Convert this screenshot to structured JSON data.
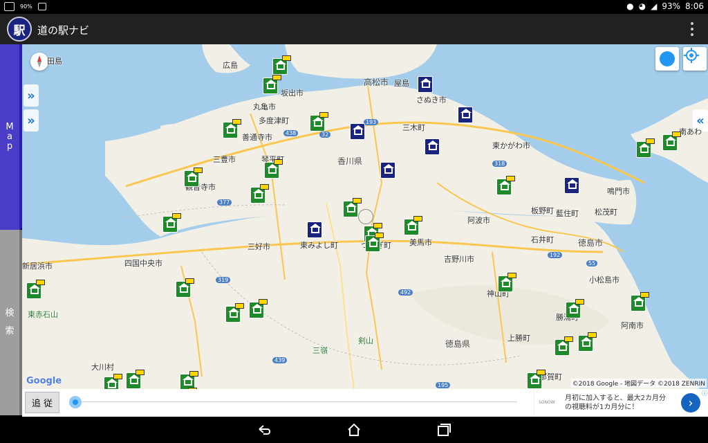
{
  "status_bar": {
    "battery_small": "90%",
    "battery": "93%",
    "time": "8:06",
    "left_icons": [
      "keyboard-icon",
      "battery-saver-icon",
      "image-icon"
    ],
    "right_icons": [
      "location-icon",
      "wifi-icon",
      "signal-icon"
    ]
  },
  "app_bar": {
    "logo_text": "駅",
    "title": "道の駅ナビ",
    "menu_icon": "overflow-menu-icon"
  },
  "side_tabs": {
    "map": [
      "M",
      "a",
      "p"
    ],
    "search": [
      "検",
      "索"
    ]
  },
  "map": {
    "place_labels": [
      {
        "name": "田島",
        "kind": "normal"
      },
      {
        "name": "広島",
        "kind": "normal"
      },
      {
        "name": "坂出市",
        "kind": "normal"
      },
      {
        "name": "高松市",
        "kind": "big"
      },
      {
        "name": "屋島",
        "kind": "normal"
      },
      {
        "name": "さぬき市",
        "kind": "normal"
      },
      {
        "name": "丸亀市",
        "kind": "normal"
      },
      {
        "name": "多度津町",
        "kind": "normal"
      },
      {
        "name": "善通寺市",
        "kind": "normal"
      },
      {
        "name": "三木町",
        "kind": "normal"
      },
      {
        "name": "東かがわ市",
        "kind": "normal"
      },
      {
        "name": "南あわ",
        "kind": "normal"
      },
      {
        "name": "三豊市",
        "kind": "normal"
      },
      {
        "name": "琴平町",
        "kind": "normal"
      },
      {
        "name": "香川県",
        "kind": "big"
      },
      {
        "name": "観音寺市",
        "kind": "normal"
      },
      {
        "name": "鳴門市",
        "kind": "normal"
      },
      {
        "name": "板野町",
        "kind": "normal"
      },
      {
        "name": "藍住町",
        "kind": "normal"
      },
      {
        "name": "松茂町",
        "kind": "normal"
      },
      {
        "name": "阿波市",
        "kind": "normal"
      },
      {
        "name": "石井町",
        "kind": "normal"
      },
      {
        "name": "三好市",
        "kind": "normal"
      },
      {
        "name": "東みよし町",
        "kind": "normal"
      },
      {
        "name": "つるぎ町",
        "kind": "normal"
      },
      {
        "name": "美馬市",
        "kind": "normal"
      },
      {
        "name": "徳島市",
        "kind": "big"
      },
      {
        "name": "四国中央市",
        "kind": "normal"
      },
      {
        "name": "吉野川市",
        "kind": "normal"
      },
      {
        "name": "新居浜市",
        "kind": "normal"
      },
      {
        "name": "小松島市",
        "kind": "normal"
      },
      {
        "name": "神山町",
        "kind": "normal"
      },
      {
        "name": "勝浦町",
        "kind": "normal"
      },
      {
        "name": "東赤石山",
        "kind": "green"
      },
      {
        "name": "阿南市",
        "kind": "normal"
      },
      {
        "name": "剣山",
        "kind": "green"
      },
      {
        "name": "上勝町",
        "kind": "normal"
      },
      {
        "name": "三嶺",
        "kind": "green"
      },
      {
        "name": "徳島県",
        "kind": "big"
      },
      {
        "name": "大川村",
        "kind": "normal"
      },
      {
        "name": "那賀町",
        "kind": "normal"
      }
    ],
    "road_shields": [
      "438",
      "32",
      "193",
      "318",
      "377",
      "319",
      "192",
      "55",
      "492",
      "439",
      "195"
    ],
    "markers": [
      {
        "kind": "green",
        "flag": true
      },
      {
        "kind": "green",
        "flag": true
      },
      {
        "kind": "blue",
        "flag": false
      },
      {
        "kind": "blue",
        "flag": false
      },
      {
        "kind": "blue",
        "flag": false
      },
      {
        "kind": "green",
        "flag": true
      },
      {
        "kind": "green",
        "flag": true
      },
      {
        "kind": "blue",
        "flag": false
      },
      {
        "kind": "blue",
        "flag": false
      },
      {
        "kind": "green",
        "flag": true
      },
      {
        "kind": "green",
        "flag": true
      },
      {
        "kind": "green",
        "flag": true
      },
      {
        "kind": "blue",
        "flag": false
      },
      {
        "kind": "green",
        "flag": true
      },
      {
        "kind": "green",
        "flag": true
      },
      {
        "kind": "green",
        "flag": true
      },
      {
        "kind": "green",
        "flag": true
      },
      {
        "kind": "green",
        "flag": true
      },
      {
        "kind": "blue",
        "flag": false
      },
      {
        "kind": "green",
        "flag": true
      },
      {
        "kind": "green",
        "flag": true
      },
      {
        "kind": "green",
        "flag": true
      },
      {
        "kind": "green",
        "flag": true
      },
      {
        "kind": "green",
        "flag": true
      },
      {
        "kind": "green",
        "flag": true
      },
      {
        "kind": "green",
        "flag": true
      },
      {
        "kind": "green",
        "flag": true
      },
      {
        "kind": "green",
        "flag": true
      },
      {
        "kind": "green",
        "flag": true
      },
      {
        "kind": "green",
        "flag": true
      },
      {
        "kind": "green",
        "flag": true
      },
      {
        "kind": "green",
        "flag": true
      },
      {
        "kind": "green",
        "flag": true
      },
      {
        "kind": "green",
        "flag": true
      },
      {
        "kind": "green",
        "flag": true
      },
      {
        "kind": "green",
        "flag": true
      }
    ],
    "google_logo": "Google",
    "copyright": "©2018 Google - 地図データ ©2018 ZENRIN",
    "buttons": {
      "compass": "compass-icon",
      "navigation": "navigation-icon",
      "my_location": "my-location-icon",
      "expand_left_1": "»",
      "expand_left_2": "»",
      "expand_right": "«"
    }
  },
  "bottom_bar": {
    "follow_label": "追 従",
    "slider_value": 0
  },
  "ad": {
    "brand": "SONOW",
    "text_line1": "月初に加入すると、最大2カ月分",
    "text_line2": "の視聴料が1カ月分に！",
    "button": "›",
    "close": "ⓘ"
  },
  "nav_bar": {
    "back": "back-icon",
    "home": "home-icon",
    "recents": "recents-icon"
  },
  "colors": {
    "app_bar": "#212121",
    "map_tab": "#4b3cc7",
    "search_tab": "#9e9e9e",
    "water": "#a3cdea",
    "land": "#f2efe6",
    "marker_green": "#1e8a2a",
    "marker_blue": "#1a237e",
    "accent": "#2196f3"
  }
}
